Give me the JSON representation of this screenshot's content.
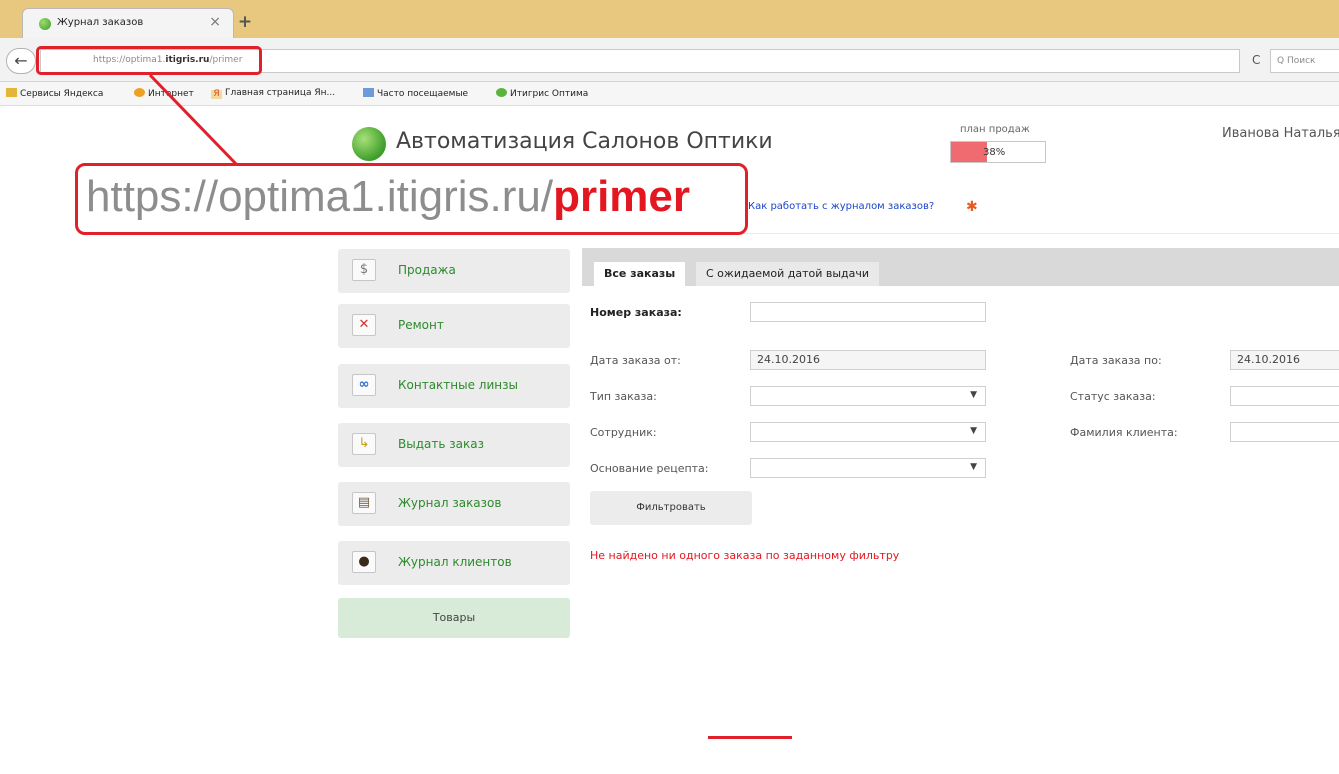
{
  "browser": {
    "tab_title": "Журнал заказов",
    "tab_close": "×",
    "new_tab": "+",
    "url_prefix": "https://optima1.",
    "url_host": "itigris.ru",
    "url_path": "/primer",
    "reload_glyph": "C",
    "search_placeholder": "Q Поиск"
  },
  "bookmarks": [
    "Сервисы Яндекса",
    "Интернет",
    "Главная страница Ян...",
    "Часто посещаемые",
    "Итигрис Оптима"
  ],
  "annotation": {
    "url_base": "https://optima1.itigris.ru/",
    "url_highlight": "primer",
    "color": "#e0202a"
  },
  "header": {
    "app_title": "Автоматизация Салонов Оптики",
    "sales_plan_label": "план продаж",
    "sales_plan_value": "38%",
    "sales_plan_fraction": 0.38,
    "user_name": "Иванова Наталья",
    "help_link": "Как работать с журналом заказов?",
    "help_icon": "✱"
  },
  "sidebar": {
    "items": [
      {
        "label": "Продажа",
        "icon": "money-icon",
        "glyph": "$"
      },
      {
        "label": "Ремонт",
        "icon": "repair-icon",
        "glyph": "✕"
      },
      {
        "label": "Контактные линзы",
        "icon": "lenses-icon",
        "glyph": "∞"
      },
      {
        "label": "Выдать заказ",
        "icon": "issue-order-icon",
        "glyph": "↳"
      },
      {
        "label": "Журнал заказов",
        "icon": "orders-journal-icon",
        "glyph": "▤"
      },
      {
        "label": "Журнал клиентов",
        "icon": "clients-journal-icon",
        "glyph": "●"
      }
    ],
    "goods": "Товары"
  },
  "tabs": [
    {
      "label": "Все заказы",
      "active": true
    },
    {
      "label": "С ожидаемой датой выдачи",
      "active": false
    }
  ],
  "filters": {
    "order_number_label": "Номер заказа:",
    "order_number_value": "",
    "date_from_label": "Дата заказа от:",
    "date_from_value": "24.10.2016",
    "date_to_label": "Дата заказа по:",
    "date_to_value": "24.10.2016",
    "order_type_label": "Тип заказа:",
    "order_type_value": "",
    "order_status_label": "Статус заказа:",
    "order_status_value": "",
    "employee_label": "Сотрудник:",
    "employee_value": "",
    "client_lastname_label": "Фамилия клиента:",
    "client_lastname_value": "",
    "prescription_basis_label": "Основание рецепта:",
    "prescription_basis_value": "",
    "dropdown_arrow": "▼",
    "filter_button": "Фильтровать"
  },
  "messages": {
    "empty_result": "Не найдено ни одного заказа по заданному фильтру"
  },
  "colors": {
    "accent_green": "#2d8a2d",
    "error_red": "#e3171f",
    "sales_bar": "#ef6b70"
  }
}
